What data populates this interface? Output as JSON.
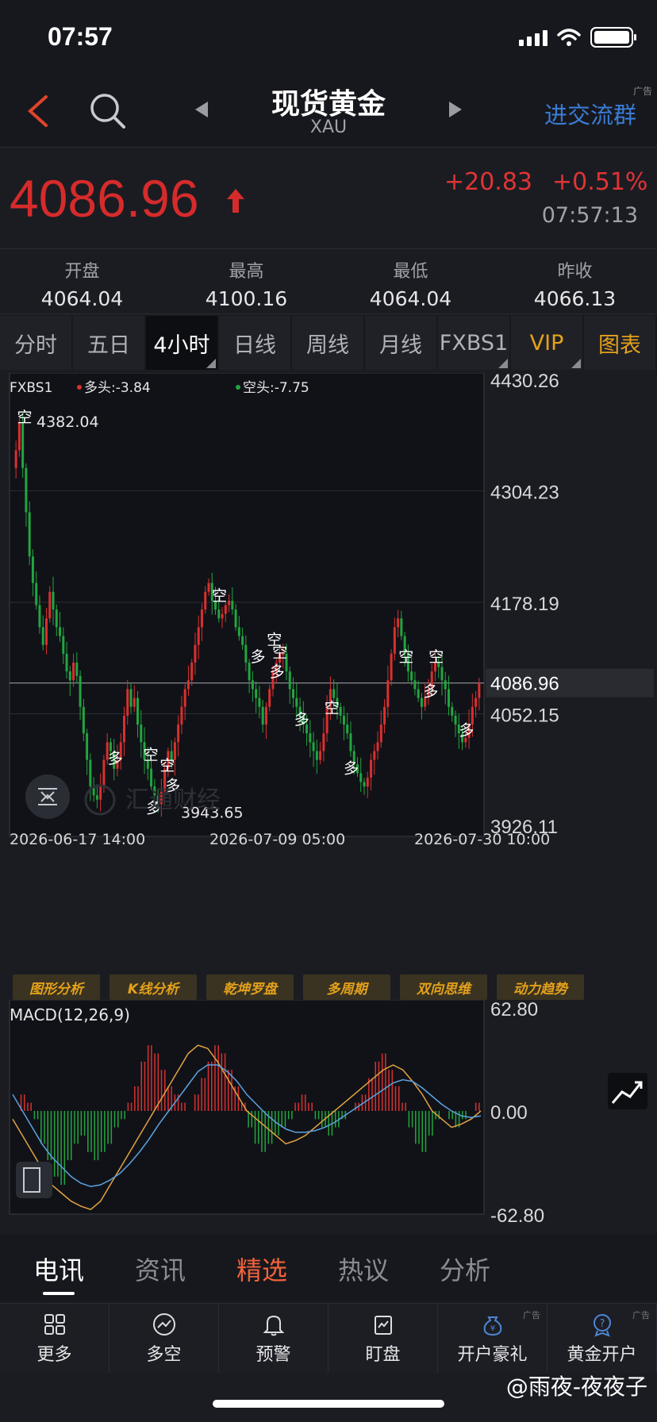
{
  "status": {
    "time": "07:57"
  },
  "nav": {
    "title": "现货黄金",
    "code": "XAU",
    "group_link": "进交流群",
    "ad_tag": "广告"
  },
  "quote": {
    "last": "4086.96",
    "change_abs": "+20.83",
    "change_pct": "+0.51%",
    "time": "07:57:13",
    "up_color": "#d62b2b",
    "down_color": "#23a645"
  },
  "ohlc": [
    {
      "label": "开盘",
      "value": "4064.04"
    },
    {
      "label": "最高",
      "value": "4100.16"
    },
    {
      "label": "最低",
      "value": "4064.04"
    },
    {
      "label": "昨收",
      "value": "4066.13"
    }
  ],
  "periods": [
    {
      "label": "分时"
    },
    {
      "label": "五日"
    },
    {
      "label": "4小时",
      "active": true,
      "corner": true
    },
    {
      "label": "日线"
    },
    {
      "label": "周线"
    },
    {
      "label": "月线"
    },
    {
      "label": "FXBS1",
      "corner": true
    },
    {
      "label": "VIP",
      "gold": true,
      "corner": true
    },
    {
      "label": "图表",
      "gold": true
    }
  ],
  "chart_data": [
    {
      "type": "candlestick",
      "indicator_label": "FXBS1",
      "long_label": "多头:-3.84",
      "short_label": "空头:-7.75",
      "ylim": [
        3926.11,
        4430.26
      ],
      "y_ticks": [
        "4430.26",
        "4304.23",
        "4178.19",
        "4052.15",
        "3926.11"
      ],
      "current_price_tag": "4086.96",
      "current_price": 4086.96,
      "x_ticks": [
        "2026-06-17 14:00",
        "2026-07-09 05:00",
        "2026-07-30 10:00"
      ],
      "high_note": "4382.04",
      "low_note": "3943.65",
      "signal_marks": [
        {
          "text": "空",
          "x_index": 1,
          "price": 4382
        },
        {
          "text": "多",
          "x_index": 34,
          "price": 3996
        },
        {
          "text": "空",
          "x_index": 47,
          "price": 4000
        },
        {
          "text": "空",
          "x_index": 53,
          "price": 3988
        },
        {
          "text": "多",
          "x_index": 55,
          "price": 3965
        },
        {
          "text": "多",
          "x_index": 48,
          "price": 3940
        },
        {
          "text": "空",
          "x_index": 72,
          "price": 4180
        },
        {
          "text": "多",
          "x_index": 86,
          "price": 4111
        },
        {
          "text": "空",
          "x_index": 92,
          "price": 4130
        },
        {
          "text": "空",
          "x_index": 94,
          "price": 4116
        },
        {
          "text": "多",
          "x_index": 93,
          "price": 4094
        },
        {
          "text": "多",
          "x_index": 102,
          "price": 4040
        },
        {
          "text": "空",
          "x_index": 113,
          "price": 4053
        },
        {
          "text": "多",
          "x_index": 120,
          "price": 3985
        },
        {
          "text": "空",
          "x_index": 140,
          "price": 4111
        },
        {
          "text": "多",
          "x_index": 149,
          "price": 4072
        },
        {
          "text": "空",
          "x_index": 151,
          "price": 4111
        },
        {
          "text": "多",
          "x_index": 162,
          "price": 4028
        }
      ],
      "close_path": [
        4350,
        4382,
        4330,
        4280,
        4230,
        4200,
        4175,
        4150,
        4130,
        4160,
        4190,
        4170,
        4150,
        4140,
        4120,
        4100,
        4090,
        4110,
        4095,
        4060,
        4030,
        4000,
        3970,
        3960,
        3955,
        3970,
        4000,
        4020,
        4010,
        3990,
        4000,
        4020,
        4050,
        4080,
        4060,
        4070,
        4040,
        4020,
        4000,
        3990,
        3970,
        3960,
        3950,
        3965,
        3990,
        4010,
        4000,
        4020,
        4040,
        4060,
        4080,
        4090,
        4110,
        4130,
        4150,
        4170,
        4190,
        4200,
        4180,
        4170,
        4160,
        4165,
        4175,
        4180,
        4170,
        4150,
        4140,
        4130,
        4110,
        4090,
        4080,
        4070,
        4060,
        4040,
        4060,
        4080,
        4100,
        4110,
        4120,
        4120,
        4100,
        4080,
        4070,
        4060,
        4050,
        4040,
        4030,
        4020,
        4010,
        4000,
        4010,
        4030,
        4060,
        4080,
        4070,
        4060,
        4050,
        4040,
        4030,
        4010,
        3995,
        3985,
        3975,
        3970,
        3980,
        4000,
        4010,
        4020,
        4040,
        4060,
        4090,
        4120,
        4150,
        4160,
        4140,
        4120,
        4100,
        4090,
        4080,
        4070,
        4060,
        4070,
        4080,
        4100,
        4110,
        4105,
        4090,
        4080,
        4060,
        4050,
        4040,
        4030,
        4020,
        4025,
        4040,
        4060,
        4070,
        4086.96
      ]
    },
    {
      "type": "macd",
      "label": "MACD(12,26,9)",
      "ylim": [
        -62.8,
        62.8
      ],
      "y_ticks": [
        "62.80",
        "0.00",
        "-62.80"
      ],
      "histogram_sample": [
        0,
        10,
        5,
        -5,
        -20,
        -30,
        -40,
        -45,
        -30,
        -20,
        -15,
        -25,
        -30,
        -25,
        -20,
        -10,
        -5,
        5,
        15,
        30,
        40,
        35,
        25,
        15,
        10,
        5,
        0,
        10,
        20,
        30,
        40,
        35,
        25,
        15,
        5,
        -10,
        -20,
        -25,
        -20,
        -15,
        -10,
        -5,
        5,
        10,
        5,
        -5,
        -10,
        -15,
        -10,
        -5,
        0,
        5,
        10,
        20,
        30,
        35,
        25,
        15,
        5,
        -10,
        -20,
        -25,
        -15,
        -5,
        0,
        -5,
        -10,
        -5,
        0,
        5
      ],
      "dif": [
        -5,
        -15,
        -25,
        -35,
        -45,
        -50,
        -55,
        -58,
        -60,
        -55,
        -45,
        -35,
        -25,
        -15,
        -5,
        5,
        15,
        25,
        35,
        40,
        38,
        30,
        20,
        10,
        0,
        -5,
        -10,
        -15,
        -20,
        -18,
        -15,
        -10,
        -5,
        0,
        5,
        10,
        15,
        20,
        25,
        28,
        25,
        18,
        10,
        0,
        -5,
        -10,
        -8,
        -5,
        0
      ],
      "dea": [
        10,
        0,
        -10,
        -20,
        -28,
        -34,
        -40,
        -44,
        -46,
        -45,
        -42,
        -38,
        -32,
        -25,
        -17,
        -8,
        0,
        8,
        16,
        24,
        28,
        28,
        24,
        18,
        10,
        4,
        -2,
        -7,
        -11,
        -13,
        -13,
        -12,
        -10,
        -7,
        -3,
        1,
        5,
        9,
        13,
        17,
        19,
        18,
        14,
        9,
        4,
        0,
        -3,
        -4,
        -3
      ]
    }
  ],
  "tools": [
    "图形分析",
    "K线分析",
    "乾坤罗盘",
    "多周期",
    "双向思维",
    "动力趋势"
  ],
  "news_tabs": [
    {
      "label": "电讯",
      "active": true
    },
    {
      "label": "资讯"
    },
    {
      "label": "精选",
      "hot": true
    },
    {
      "label": "热议"
    },
    {
      "label": "分析"
    }
  ],
  "bottom_nav": [
    {
      "label": "更多",
      "icon": "grid-icon"
    },
    {
      "label": "多空",
      "icon": "trend-circle-icon"
    },
    {
      "label": "预警",
      "icon": "bell-icon"
    },
    {
      "label": "盯盘",
      "icon": "chart-window-icon"
    },
    {
      "label": "开户豪礼",
      "icon": "money-bag-icon",
      "ad": "广告"
    },
    {
      "label": "黄金开户",
      "icon": "gold-account-icon",
      "ad": "广告"
    }
  ],
  "watermark": "@雨夜-夜夜子",
  "chart_watermark": "汇通财经"
}
